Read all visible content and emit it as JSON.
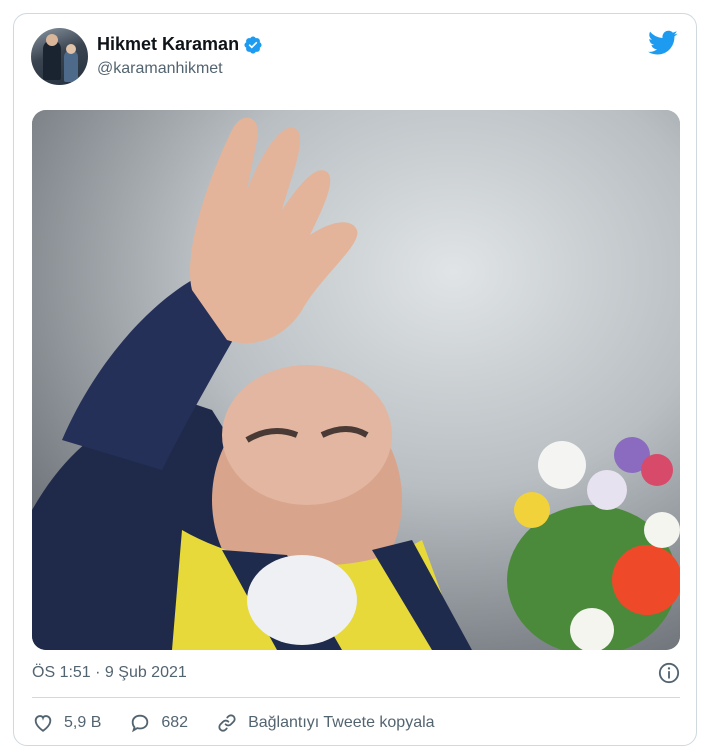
{
  "author": {
    "name": "Hikmet Karaman",
    "handle": "@karamanhikmet",
    "verified": true
  },
  "tweet": {
    "timestamp": "ÖS 1:51 · 9 Şub 2021"
  },
  "actions": {
    "likes": "5,9 B",
    "replies": "682",
    "copy_link_label": "Bağlantıyı Tweete kopyala"
  },
  "icons": {
    "verified": "verified-badge-icon",
    "brand": "twitter-bird-icon",
    "info": "info-icon",
    "like": "heart-icon",
    "reply": "speech-bubble-icon",
    "link": "link-icon"
  },
  "colors": {
    "brand": "#1d9bf0",
    "muted_text": "#536471",
    "border": "#cfd9de"
  }
}
